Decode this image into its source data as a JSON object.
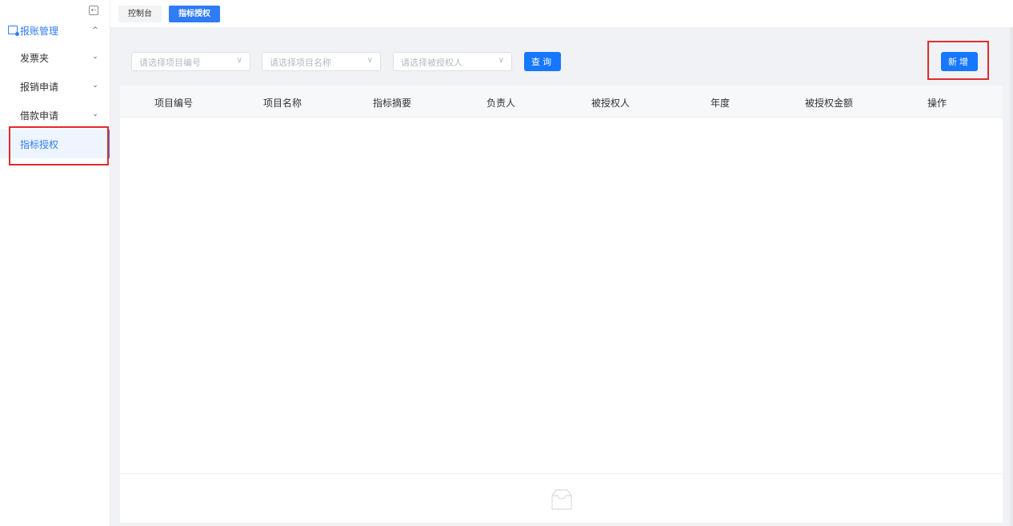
{
  "sidebar": {
    "group_label": "报账管理",
    "items": [
      {
        "label": "发票夹"
      },
      {
        "label": "报销申请"
      },
      {
        "label": "借款申请"
      },
      {
        "label": "指标授权"
      }
    ]
  },
  "tabs": [
    {
      "label": "控制台"
    },
    {
      "label": "指标授权"
    }
  ],
  "filters": {
    "project_code_placeholder": "请选择项目编号",
    "project_name_placeholder": "请选择项目名称",
    "grantee_placeholder": "请选择被授权人",
    "query_label": "查询"
  },
  "toolbar": {
    "add_label": "新增"
  },
  "table": {
    "columns": [
      "项目编号",
      "项目名称",
      "指标摘要",
      "负责人",
      "被授权人",
      "年度",
      "被授权金额",
      "操作"
    ]
  },
  "colors": {
    "primary": "#1677ff",
    "highlight": "#e22b2b"
  }
}
